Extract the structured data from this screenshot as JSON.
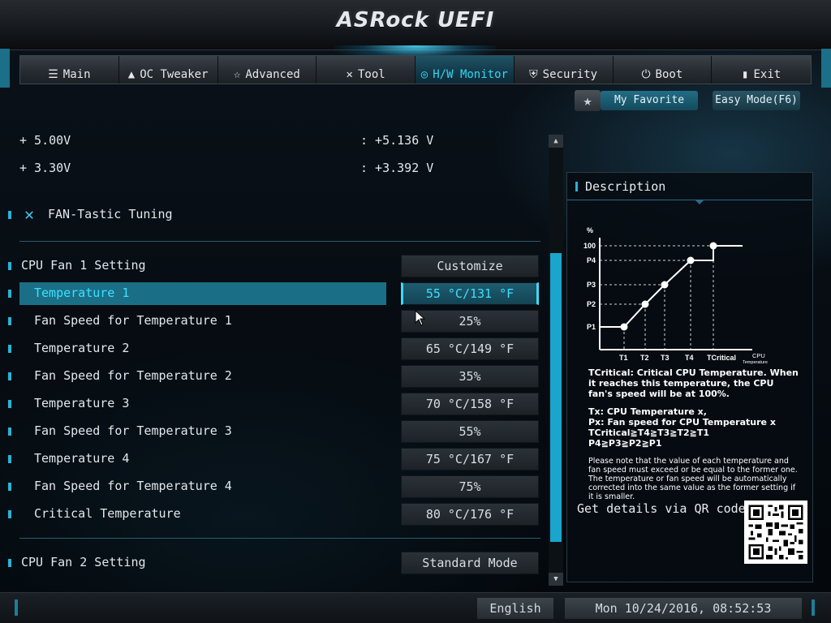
{
  "header": {
    "title": "ASRock UEFI"
  },
  "nav": {
    "tabs": [
      {
        "label": "Main",
        "icon": "list-icon"
      },
      {
        "label": "OC Tweaker",
        "icon": "rocket-icon"
      },
      {
        "label": "Advanced",
        "icon": "star-icon"
      },
      {
        "label": "Tool",
        "icon": "tools-icon"
      },
      {
        "label": "H/W Monitor",
        "icon": "monitor-gauge-icon",
        "active": true
      },
      {
        "label": "Security",
        "icon": "shield-icon"
      },
      {
        "label": "Boot",
        "icon": "power-icon"
      },
      {
        "label": "Exit",
        "icon": "exit-door-icon"
      }
    ]
  },
  "toolbar": {
    "favorite_label": "My Favorite",
    "easy_mode_label": "Easy Mode(F6)"
  },
  "voltages": [
    {
      "label": "+ 5.00V",
      "value": ": +5.136 V"
    },
    {
      "label": "+ 3.30V",
      "value": ": +3.392 V"
    }
  ],
  "section": {
    "title": "FAN-Tastic Tuning"
  },
  "settings": [
    {
      "label": "CPU Fan 1 Setting",
      "value": "Customize"
    },
    {
      "label": "Temperature 1",
      "value": "55 °C/131 °F",
      "selected": true
    },
    {
      "label": "Fan Speed for Temperature 1",
      "value": "25%"
    },
    {
      "label": "Temperature 2",
      "value": "65 °C/149 °F"
    },
    {
      "label": "Fan Speed for Temperature 2",
      "value": "35%"
    },
    {
      "label": "Temperature 3",
      "value": "70 °C/158 °F"
    },
    {
      "label": "Fan Speed for Temperature 3",
      "value": "55%"
    },
    {
      "label": "Temperature 4",
      "value": "75 °C/167 °F"
    },
    {
      "label": "Fan Speed for Temperature 4",
      "value": "75%"
    },
    {
      "label": "Critical Temperature",
      "value": "80 °C/176 °F"
    },
    {
      "label": "CPU Fan 2 Setting",
      "value": "Standard Mode"
    }
  ],
  "description": {
    "title": "Description",
    "chart": {
      "y_unit": "%",
      "y_labels": [
        "100",
        "P4",
        "P3",
        "P2",
        "P1"
      ],
      "x_labels": [
        "T1",
        "T2",
        "T3",
        "T4",
        "TCritical"
      ],
      "x_unit_line1": "CPU",
      "x_unit_line2": "Temperature"
    },
    "text1": "TCritical: Critical CPU Temperature. When it reaches this temperature, the CPU fan's speed will be at 100%.",
    "text2_lines": [
      "Tx: CPU Temperature x,",
      "Px: Fan speed for CPU Temperature x",
      "TCritical≧T4≧T3≧T2≧T1",
      "P4≧P3≧P2≧P1"
    ],
    "text3": "Please note that the value of each temperature and fan speed must exceed or be equal to the former one. The temperature or fan speed will be automatically corrected into the same value as the former setting if it is smaller.",
    "qr_label": "Get details via QR code"
  },
  "status": {
    "language": "English",
    "datetime": "Mon 10/24/2016, 08:52:53"
  }
}
